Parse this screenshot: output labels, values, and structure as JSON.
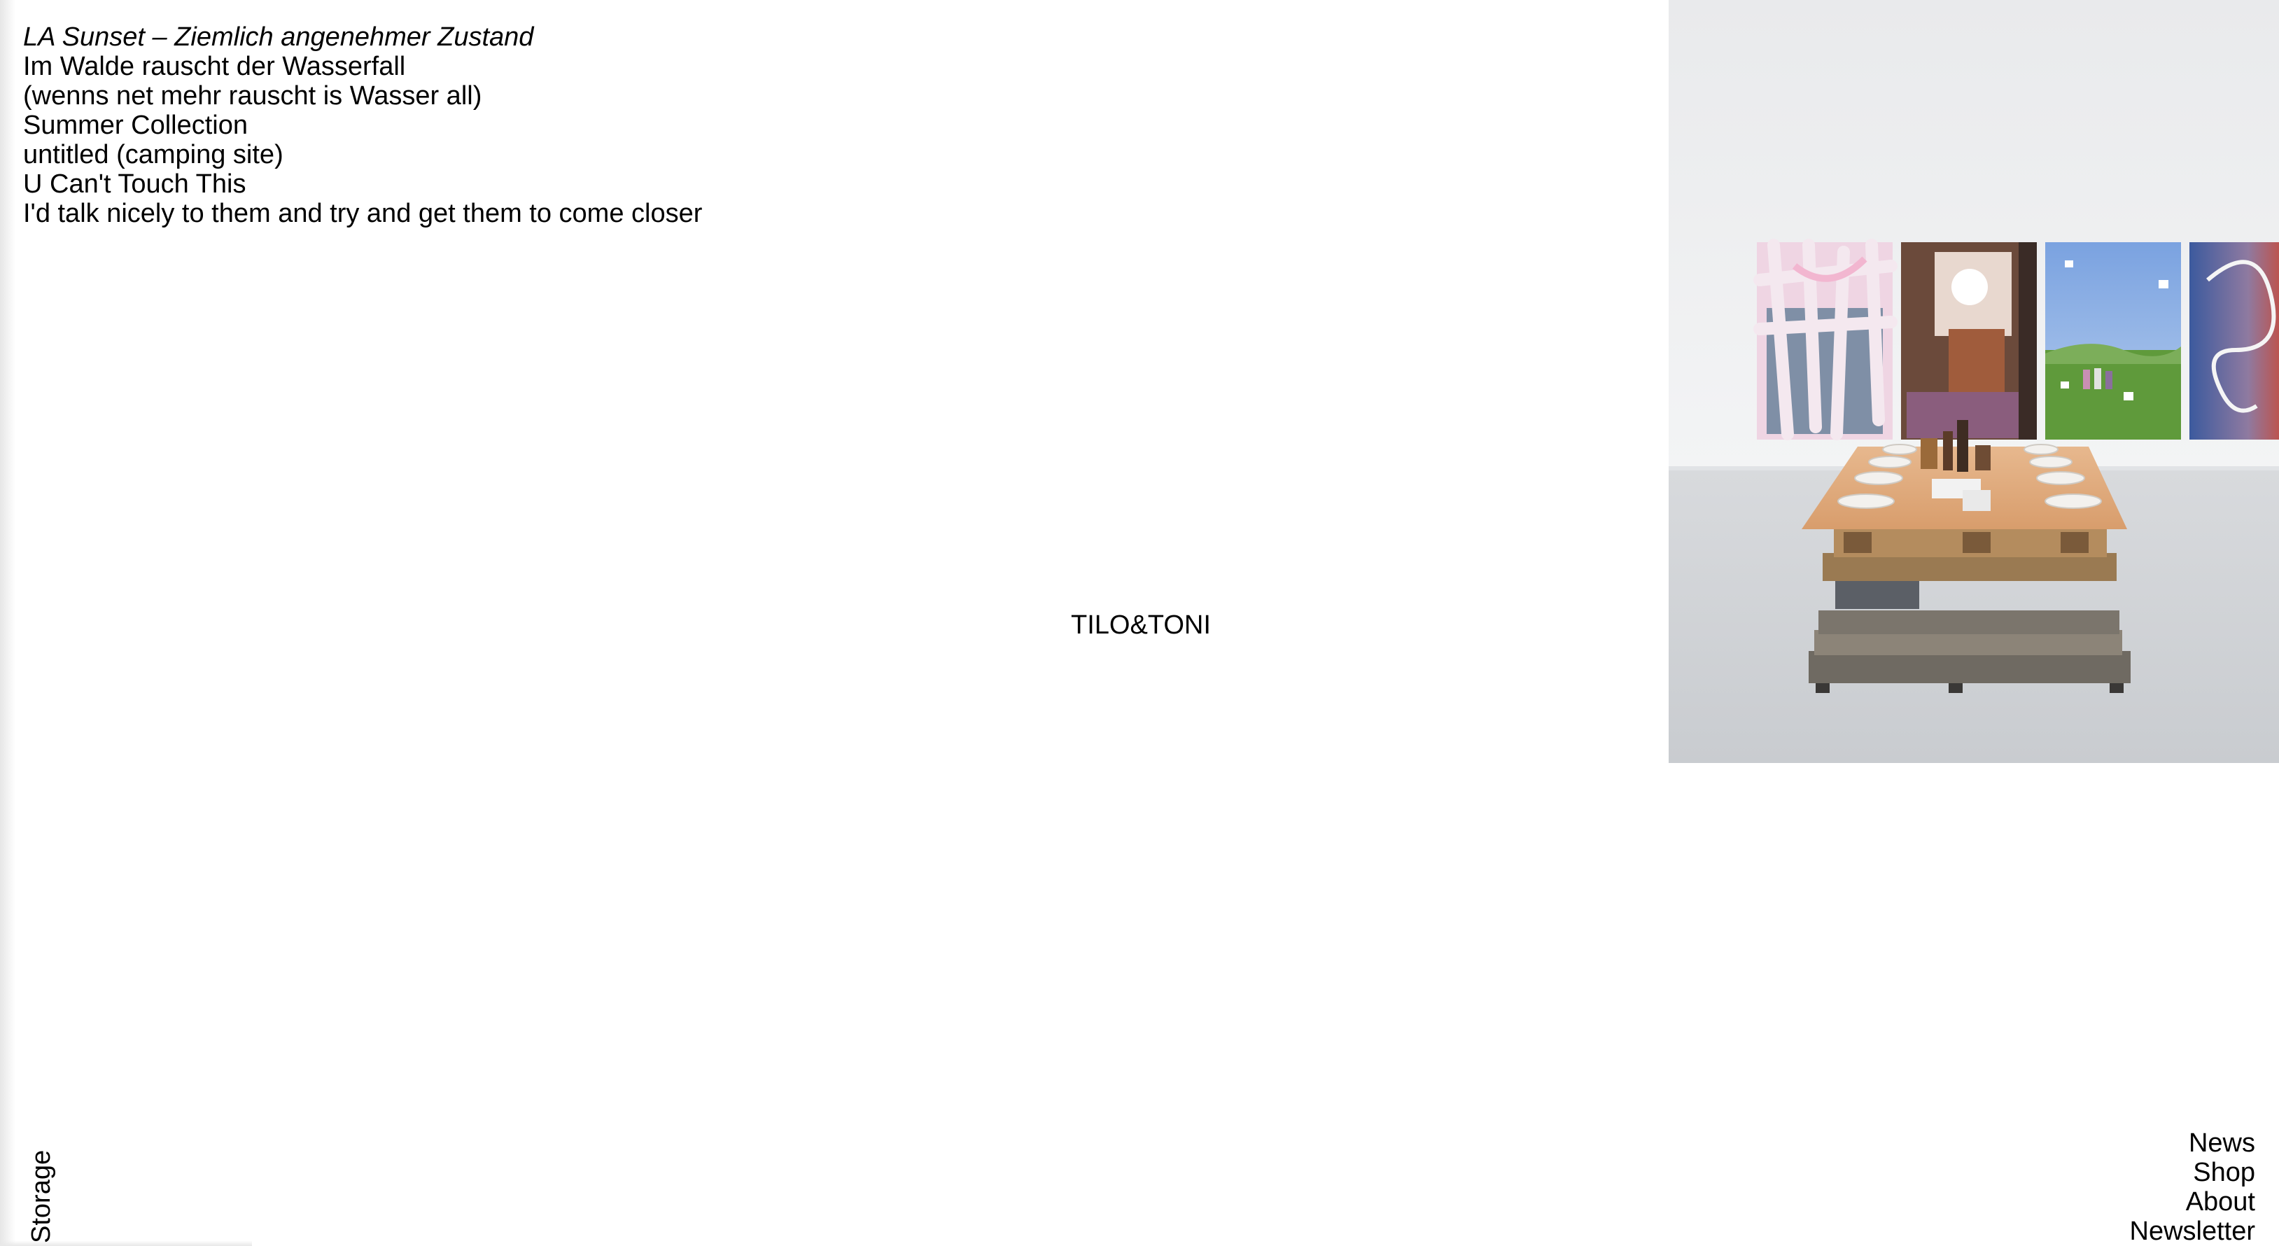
{
  "projects": [
    {
      "label": "LA Sunset – Ziemlich angenehmer Zustand"
    },
    {
      "label": "Im Walde rauscht der Wasserfall"
    },
    {
      "label": "(wenns net mehr rauscht is Wasser all)"
    },
    {
      "label": "Summer Collection"
    },
    {
      "label": "untitled (camping site)"
    },
    {
      "label": "U Can't Touch This"
    },
    {
      "label": "I'd talk nicely to them and try and get them to come closer"
    }
  ],
  "brand": "TILO&TONI",
  "storage_label": "Storage",
  "nav": {
    "news": "News",
    "shop": "Shop",
    "about": "About",
    "newsletter": "Newsletter"
  }
}
